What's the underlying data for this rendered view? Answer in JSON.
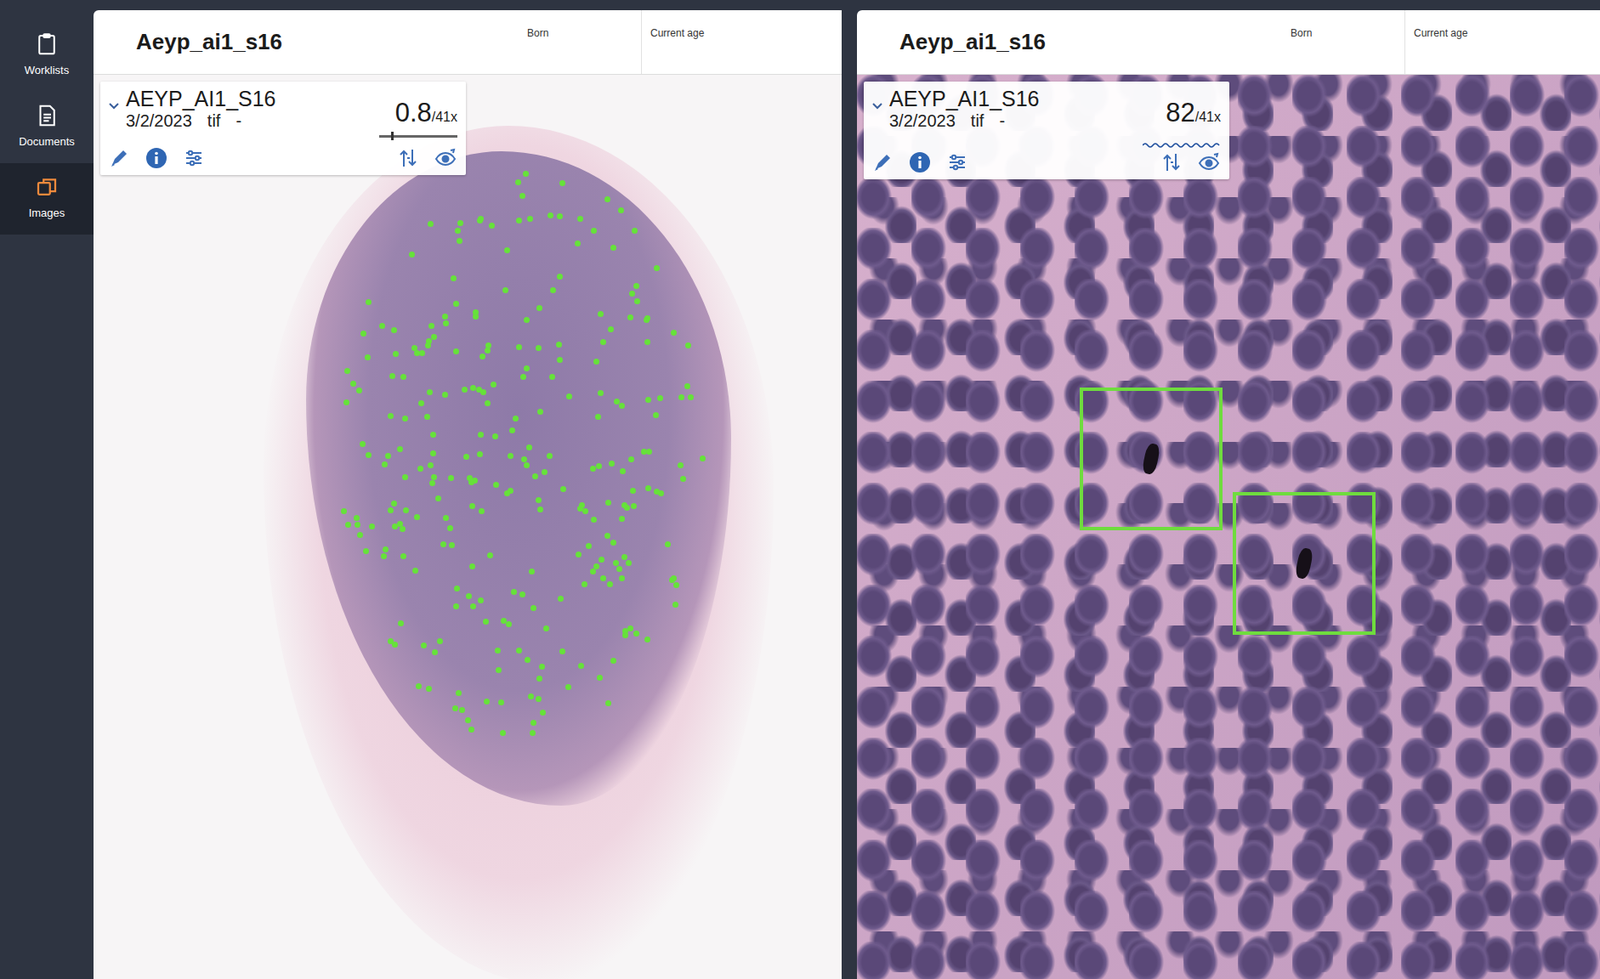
{
  "sidebar": {
    "items": [
      {
        "label": "Worklists",
        "selected": false
      },
      {
        "label": "Documents",
        "selected": false
      },
      {
        "label": "Images",
        "selected": true
      }
    ]
  },
  "viewers": [
    {
      "title": "Aeyp_ai1_s16",
      "fields": [
        "Born",
        "Current age"
      ],
      "slide": {
        "name": "AEYP_AI1_S16",
        "date": "3/2/2023",
        "format": "tif",
        "extra": "-",
        "zoom": "0.8",
        "max_zoom": "/41x",
        "zoom_indicator": {
          "kind": "slider",
          "level": 0.02
        }
      }
    },
    {
      "title": "Aeyp_ai1_s16",
      "fields": [
        "Born",
        "Current age"
      ],
      "slide": {
        "name": "AEYP_AI1_S16",
        "date": "3/2/2023",
        "format": "tif",
        "extra": "-",
        "zoom": "82",
        "max_zoom": "/41x",
        "zoom_indicator": {
          "kind": "wavy",
          "level": 1
        }
      }
    }
  ]
}
